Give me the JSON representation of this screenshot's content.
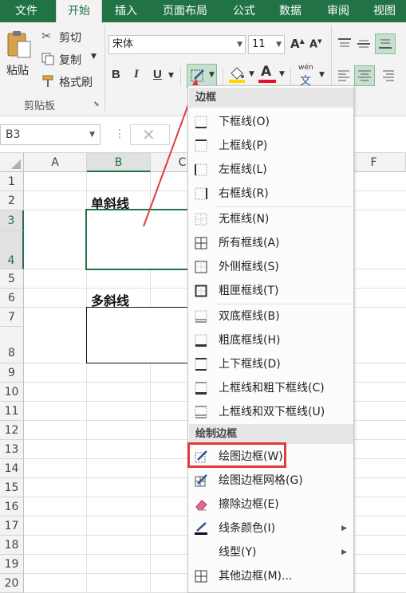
{
  "tabs": [
    "文件",
    "开始",
    "插入",
    "页面布局",
    "公式",
    "数据",
    "审阅",
    "视图"
  ],
  "ribbon": {
    "paste_label": "粘贴",
    "cut_label": "剪切",
    "copy_label": "复制",
    "format_painter_label": "格式刷",
    "clipboard_group": "剪贴板",
    "font_name": "宋体",
    "font_size": "11",
    "bold": "B",
    "italic": "I",
    "underline": "U",
    "font_grow": "A",
    "font_shrink": "A",
    "phonetic_top": "wén",
    "phonetic_bottom": "文"
  },
  "formula_bar": {
    "name_box": "B3"
  },
  "grid": {
    "columns": [
      "A",
      "B",
      "C",
      "F"
    ],
    "rows": [
      "1",
      "2",
      "3",
      "4",
      "5",
      "6",
      "7",
      "8",
      "9",
      "10",
      "11",
      "12",
      "13",
      "14",
      "15",
      "16",
      "17",
      "18",
      "19",
      "20"
    ],
    "cells": {
      "b2": "单斜线",
      "b6": "多斜线"
    }
  },
  "menu": {
    "header_borders": "边框",
    "header_draw": "绘制边框",
    "items": [
      "下框线(O)",
      "上框线(P)",
      "左框线(L)",
      "右框线(R)",
      "无框线(N)",
      "所有框线(A)",
      "外侧框线(S)",
      "粗匣框线(T)",
      "双底框线(B)",
      "粗底框线(H)",
      "上下框线(D)",
      "上框线和粗下框线(C)",
      "上框线和双下框线(U)"
    ],
    "draw_items": [
      "绘图边框(W)",
      "绘图边框网格(G)",
      "擦除边框(E)",
      "线条颜色(I)",
      "线型(Y)",
      "其他边框(M)..."
    ]
  },
  "colors": {
    "excel_green": "#217346",
    "red_annotation": "#e03c3c",
    "font_color": "#e81123",
    "fill_color": "#ffd800"
  }
}
